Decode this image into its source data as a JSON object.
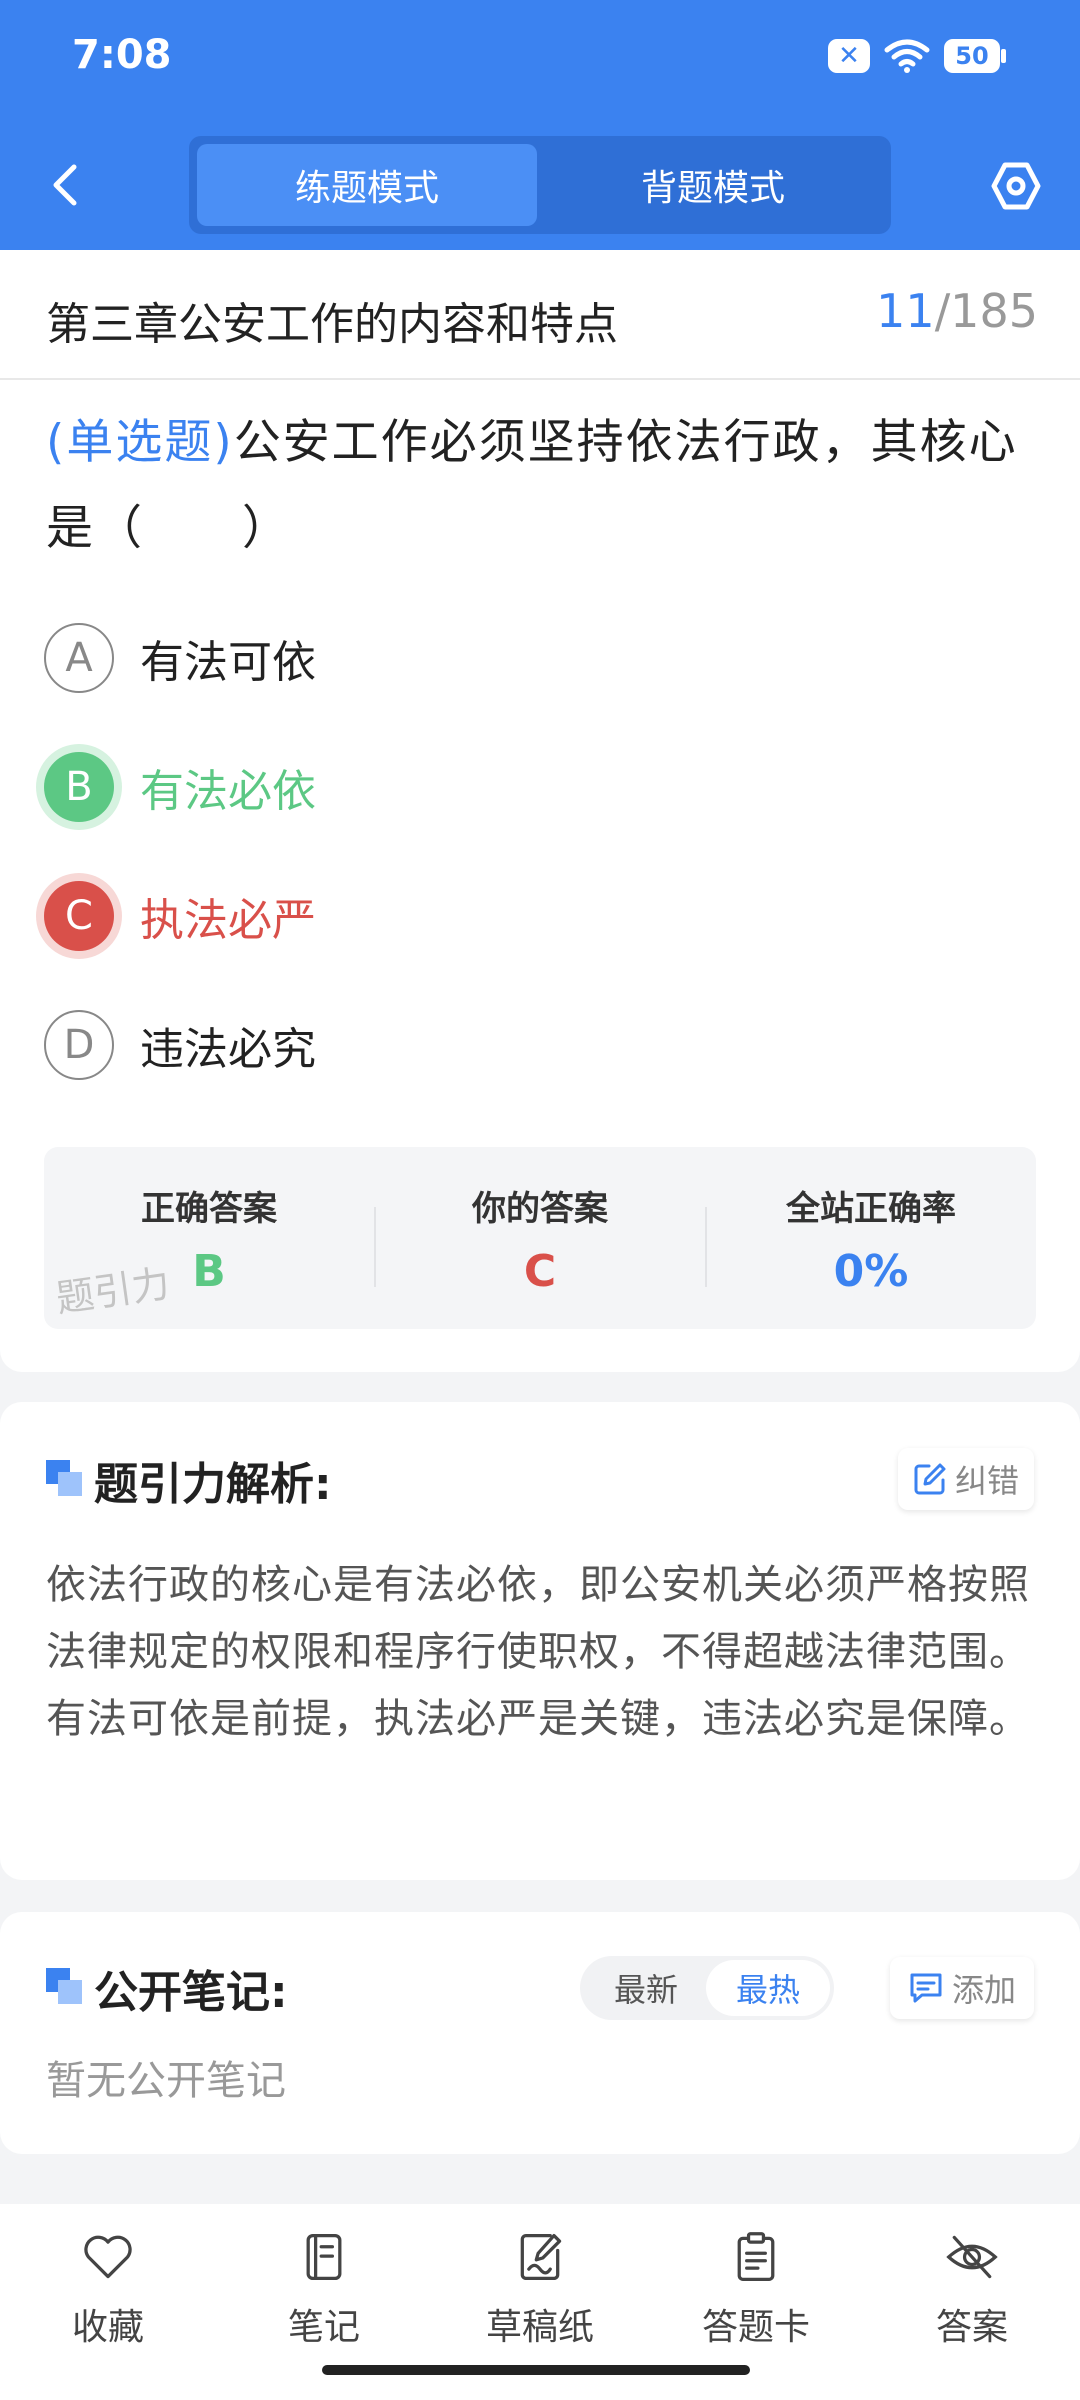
{
  "status_bar": {
    "time": "7:08",
    "battery": "50"
  },
  "header": {
    "tabs": [
      {
        "label": "练题模式"
      },
      {
        "label": "背题模式"
      }
    ]
  },
  "question_card": {
    "chapter": "第三章公安工作的内容和特点",
    "progress_current": "11",
    "progress_total": "/185",
    "type": "(单选题)",
    "text": "公安工作必须坚持依法行政，其核心是（　　）",
    "options": [
      {
        "letter": "A",
        "text": "有法可依"
      },
      {
        "letter": "B",
        "text": "有法必依"
      },
      {
        "letter": "C",
        "text": "执法必严"
      },
      {
        "letter": "D",
        "text": "违法必究"
      }
    ],
    "answer": {
      "correct_label": "正确答案",
      "correct_value": "B",
      "yours_label": "你的答案",
      "yours_value": "C",
      "rate_label": "全站正确率",
      "rate_value": "0%"
    },
    "watermark": "题引力"
  },
  "analysis": {
    "title": "题引力解析:",
    "correct_button": "纠错",
    "text": "依法行政的核心是有法必依，即公安机关必须严格按照法律规定的权限和程序行使职权，不得超越法律范围。有法可依是前提，执法必严是关键，违法必究是保障。"
  },
  "notes": {
    "title": "公开笔记:",
    "sort": {
      "latest": "最新",
      "hot": "最热"
    },
    "add_button": "添加",
    "empty": "暂无公开笔记"
  },
  "bottom_nav": [
    {
      "label": "收藏",
      "icon": "heart-icon"
    },
    {
      "label": "笔记",
      "icon": "notebook-icon"
    },
    {
      "label": "草稿纸",
      "icon": "draft-icon"
    },
    {
      "label": "答题卡",
      "icon": "clipboard-icon"
    },
    {
      "label": "答案",
      "icon": "eye-off-icon"
    }
  ],
  "colors": {
    "primary": "#3b82f0",
    "correct": "#5cc884",
    "wrong": "#d9504a"
  }
}
